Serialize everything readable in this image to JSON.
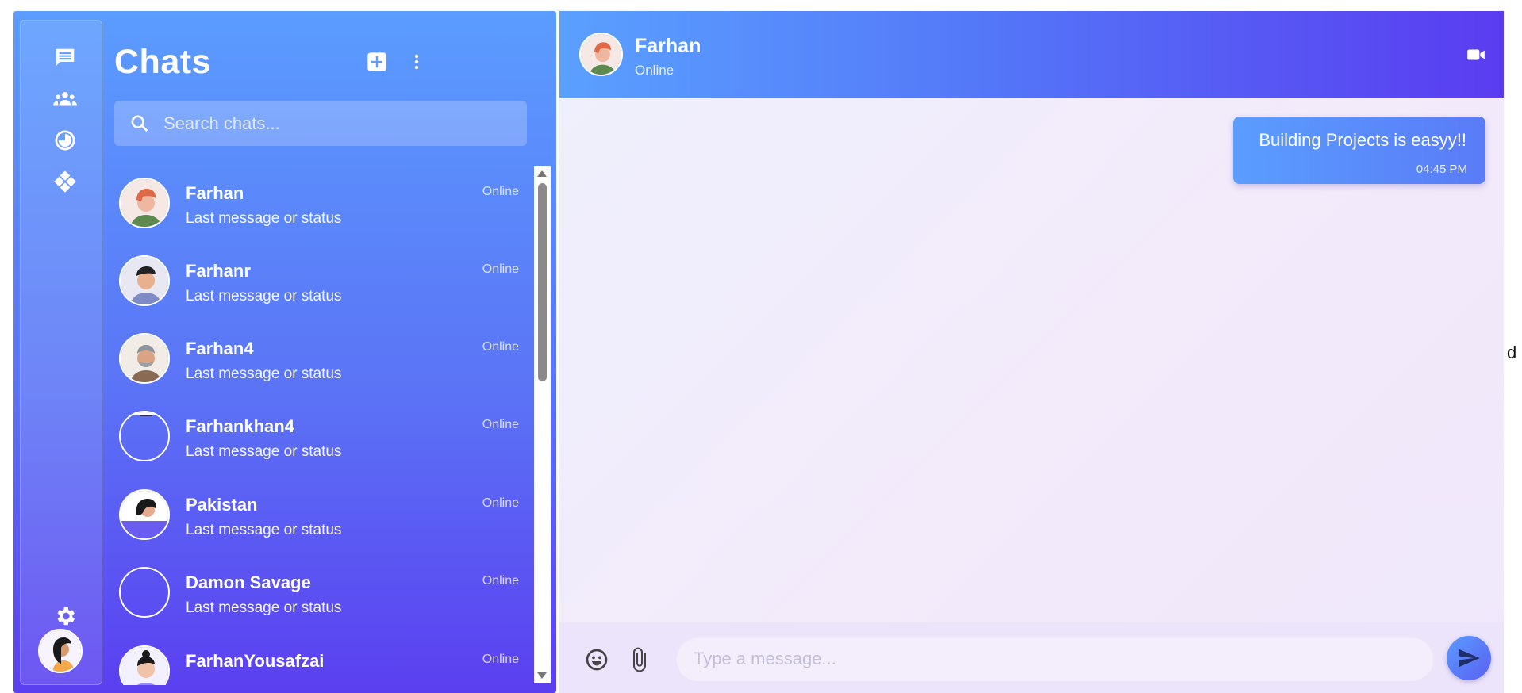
{
  "sidebar": {
    "title": "Chats",
    "search_placeholder": "Search chats...",
    "rail_icons": [
      "chat-icon",
      "groups-icon",
      "status-icon",
      "diamond-icon",
      "gear-icon"
    ],
    "chats": [
      {
        "name": "Farhan",
        "message": "Last message or status",
        "status": "Online",
        "avatar": "avatar-red-hair"
      },
      {
        "name": "Farhanr",
        "message": "Last message or status",
        "status": "Online",
        "avatar": "avatar-black-hair"
      },
      {
        "name": "Farhan4",
        "message": "Last message or status",
        "status": "Online",
        "avatar": "avatar-grey-beard"
      },
      {
        "name": "Farhankhan4",
        "message": "Last message or status",
        "status": "Online",
        "avatar": "avatar-empty"
      },
      {
        "name": "Pakistan",
        "message": "Last message or status",
        "status": "Online",
        "avatar": "avatar-woman"
      },
      {
        "name": "Damon Savage",
        "message": "Last message or status",
        "status": "Online",
        "avatar": "avatar-empty"
      },
      {
        "name": "FarhanYousafzai",
        "message": "",
        "status": "Online",
        "avatar": "avatar-bun-hair"
      }
    ]
  },
  "conversation": {
    "name": "Farhan",
    "status": "Online",
    "messages": [
      {
        "text": "Building Projects is easyy!!",
        "time": "04:45 PM",
        "outgoing": true
      }
    ],
    "input_placeholder": "Type a message..."
  },
  "stray_text": "d",
  "colors": {
    "accent_blue": "#5a9dff",
    "accent_violet": "#5a3cf0",
    "chat_bg": "#f0ebfc"
  }
}
